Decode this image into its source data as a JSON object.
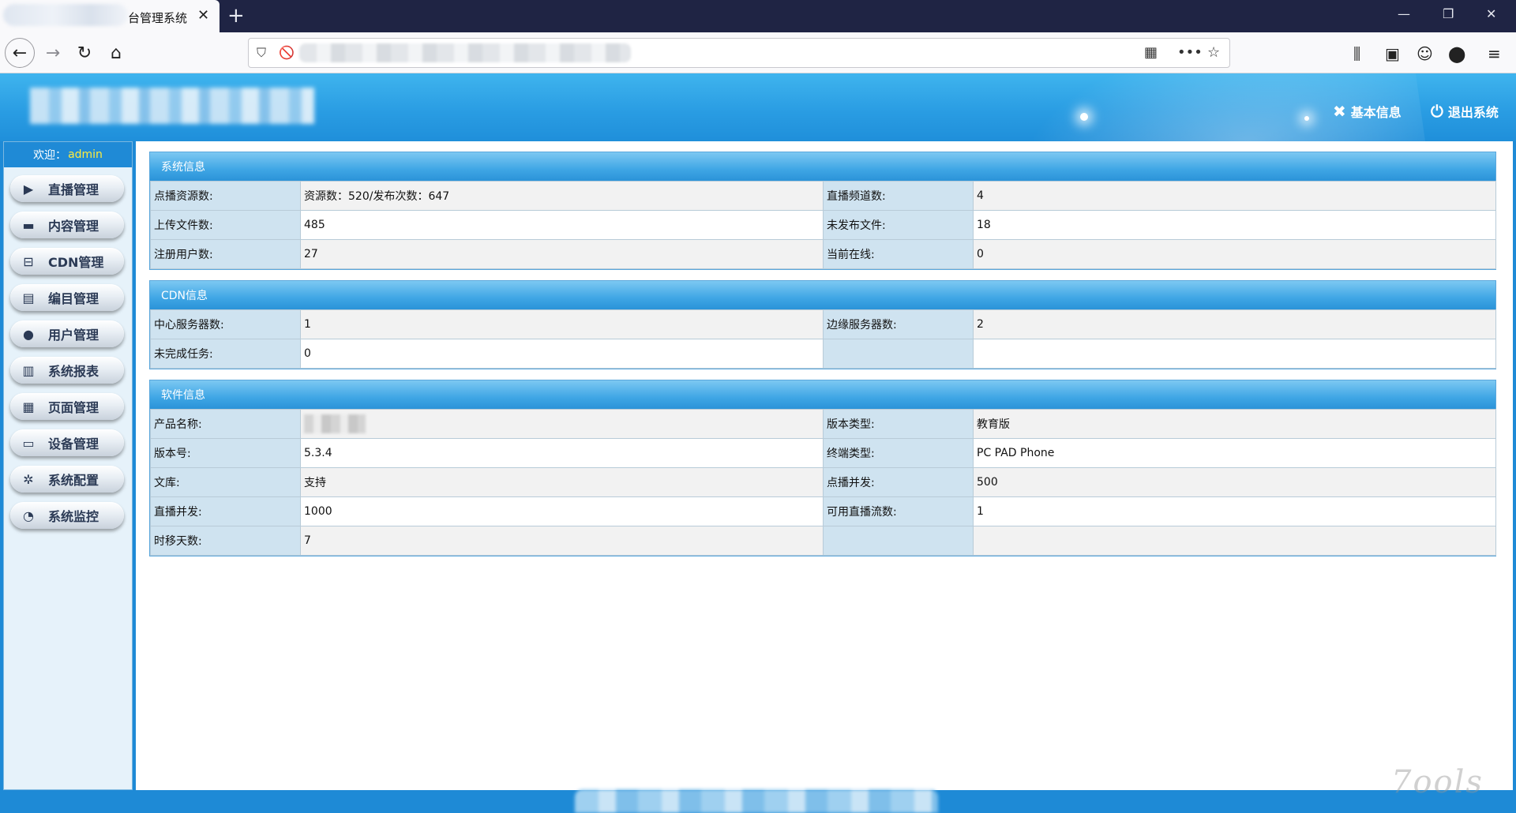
{
  "browser": {
    "tab_title": "台管理系统",
    "tab_close": "✕",
    "new_tab": "+",
    "window_controls": {
      "minimize": "—",
      "restore": "❐",
      "close": "✕"
    },
    "nav": {
      "back": "←",
      "forward": "→",
      "reload": "↻",
      "home": "⌂"
    },
    "url_icons": {
      "shield": "⛉",
      "insecure": "🚫",
      "qr": "▦",
      "more": "•••",
      "bookmark": "☆"
    },
    "toolbar": {
      "library": "⫼",
      "sidebar": "▣",
      "account": "☺",
      "extension": "⬤",
      "menu": "≡"
    }
  },
  "header": {
    "basic_info_label": "基本信息",
    "basic_info_icon": "✖",
    "logout_label": "退出系统",
    "logout_icon": "⏻"
  },
  "sidebar": {
    "welcome_prefix": "欢迎：",
    "username": "admin",
    "items": [
      {
        "label": "直播管理",
        "icon": "▶"
      },
      {
        "label": "内容管理",
        "icon": "▬"
      },
      {
        "label": "CDN管理",
        "icon": "⊟"
      },
      {
        "label": "编目管理",
        "icon": "▤"
      },
      {
        "label": "用户管理",
        "icon": "●"
      },
      {
        "label": "系统报表",
        "icon": "▥"
      },
      {
        "label": "页面管理",
        "icon": "▦"
      },
      {
        "label": "设备管理",
        "icon": "▭"
      },
      {
        "label": "系统配置",
        "icon": "✲"
      },
      {
        "label": "系统监控",
        "icon": "◔"
      }
    ]
  },
  "panels": {
    "system": {
      "title": "系统信息",
      "rows": [
        [
          "点播资源数:",
          "资源数：520/发布次数：647",
          "直播频道数:",
          "4"
        ],
        [
          "上传文件数:",
          "485",
          "未发布文件:",
          "18"
        ],
        [
          "注册用户数:",
          "27",
          "当前在线:",
          "0"
        ]
      ]
    },
    "cdn": {
      "title": "CDN信息",
      "rows": [
        [
          "中心服务器数:",
          "1",
          "边缘服务器数:",
          "2"
        ],
        [
          "未完成任务:",
          "0",
          "",
          ""
        ]
      ]
    },
    "software": {
      "title": "软件信息",
      "rows": [
        [
          "产品名称:",
          "",
          "版本类型:",
          "教育版"
        ],
        [
          "版本号:",
          "5.3.4",
          "终端类型:",
          "PC PAD Phone"
        ],
        [
          "文库:",
          "支持",
          "点播并发:",
          "500"
        ],
        [
          "直播并发:",
          "1000",
          "可用直播流数:",
          "1"
        ],
        [
          "时移天数:",
          "7",
          "",
          ""
        ]
      ]
    }
  },
  "watermark": "7ools"
}
